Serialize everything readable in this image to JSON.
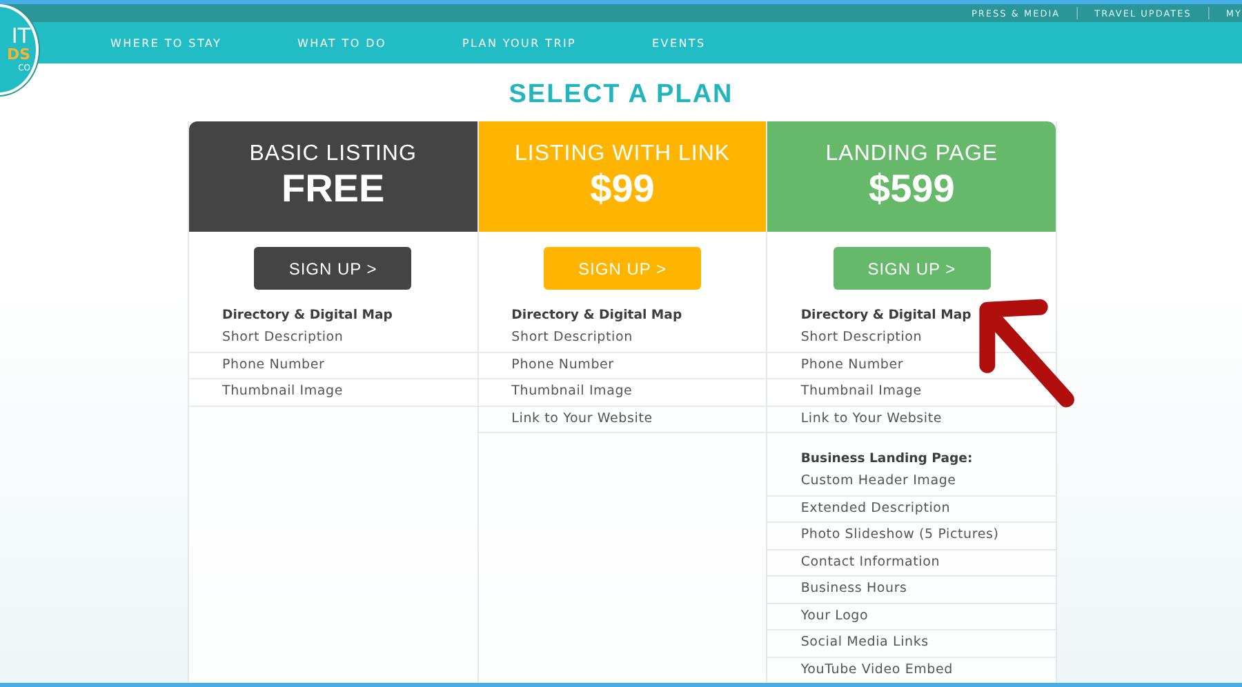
{
  "logo": {
    "lines": [
      "IT",
      "DS",
      "CO"
    ]
  },
  "utility_links": [
    {
      "kind": "link",
      "text": "PRESS & MEDIA"
    },
    {
      "kind": "separator",
      "text": "|"
    },
    {
      "kind": "link",
      "text": "TRAVEL UPDATES"
    },
    {
      "kind": "separator",
      "text": "|"
    },
    {
      "kind": "link",
      "text": "MY"
    }
  ],
  "nav": [
    "WHERE TO STAY",
    "WHAT TO DO",
    "PLAN YOUR TRIP",
    "EVENTS"
  ],
  "title": "SELECT A PLAN",
  "plans": [
    {
      "name": "BASIC LISTING",
      "price": "FREE",
      "color": "#444444",
      "button": "SIGN UP >",
      "groups": [
        {
          "heading": "Directory & Digital Map",
          "items": [
            "Short Description",
            "Phone Number",
            "Thumbnail Image"
          ]
        }
      ]
    },
    {
      "name": "LISTING WITH LINK",
      "price": "$99",
      "color": "#ffb400",
      "button": "SIGN UP >",
      "groups": [
        {
          "heading": "Directory & Digital Map",
          "items": [
            "Short Description",
            "Phone Number",
            "Thumbnail Image",
            "Link to Your Website"
          ]
        }
      ]
    },
    {
      "name": "LANDING PAGE",
      "price": "$599",
      "color": "#66b96a",
      "button": "SIGN UP >",
      "groups": [
        {
          "heading": "Directory & Digital Map",
          "items": [
            "Short Description",
            "Phone Number",
            "Thumbnail Image",
            "Link to Your Website"
          ]
        },
        {
          "heading": "Business Landing Page:",
          "items": [
            "Custom Header Image",
            "Extended Description",
            "Photo Slideshow (5 Pictures)",
            "Contact Information",
            "Business Hours",
            "Your Logo",
            "Social Media Links",
            "YouTube Video Embed"
          ]
        }
      ]
    }
  ]
}
